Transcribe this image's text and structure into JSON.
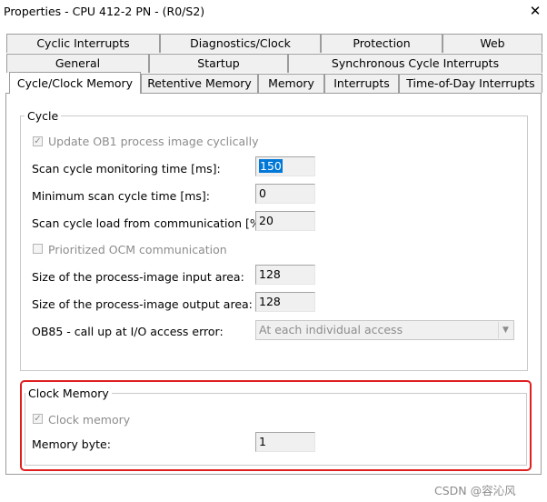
{
  "window": {
    "title": "Properties - CPU 412-2 PN - (R0/S2)"
  },
  "tabs": {
    "row1": [
      "Cyclic Interrupts",
      "Diagnostics/Clock",
      "Protection",
      "Web"
    ],
    "row2": [
      "General",
      "Startup",
      "Synchronous Cycle Interrupts"
    ],
    "row3": [
      "Cycle/Clock Memory",
      "Retentive Memory",
      "Memory",
      "Interrupts",
      "Time-of-Day Interrupts"
    ],
    "active": "Cycle/Clock Memory"
  },
  "cycle": {
    "title": "Cycle",
    "update_ob1": {
      "label": "Update OB1 process image cyclically",
      "checked": true,
      "enabled": false
    },
    "scan_monitoring": {
      "label": "Scan cycle monitoring time [ms]:",
      "value": "150"
    },
    "min_scan": {
      "label": "Minimum scan cycle time [ms]:",
      "value": "0"
    },
    "scan_load": {
      "label": "Scan cycle load from communication [%]:",
      "value": "20"
    },
    "ocm": {
      "label": "Prioritized OCM communication",
      "checked": false,
      "enabled": false
    },
    "input_area": {
      "label": "Size of the process-image input area:",
      "value": "128"
    },
    "output_area": {
      "label": "Size of the process-image output area:",
      "value": "128"
    },
    "ob85": {
      "label": "OB85 - call up at I/O access error:",
      "value": "At each individual access"
    }
  },
  "clock_memory": {
    "title": "Clock Memory",
    "checkbox": {
      "label": "Clock memory",
      "checked": true,
      "enabled": false
    },
    "memory_byte": {
      "label": "Memory byte:",
      "value": "1"
    }
  },
  "watermark": "CSDN @容沁风",
  "colors": {
    "highlight": "#e02020",
    "selection": "#0078d7"
  }
}
